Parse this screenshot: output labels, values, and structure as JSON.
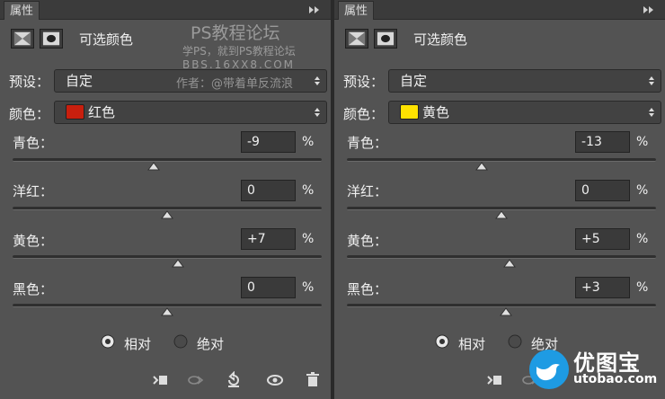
{
  "colors": {
    "panel_bg": "#535353",
    "red_swatch": "#c81f0e",
    "yellow_swatch": "#ffe200",
    "logo_blue": "#1e9be3"
  },
  "watermark": {
    "title": "PS教程论坛",
    "subtitle": "学PS，就到PS教程论坛",
    "url": "BBS.16XX8.COM",
    "author": "作者：@带着单反流浪"
  },
  "logo": {
    "name": "优图宝",
    "url": "utobao.com"
  },
  "panels": [
    {
      "tab": "属性",
      "heading": "可选颜色",
      "preset_label": "预设：",
      "preset_value": "自定",
      "color_label": "颜色：",
      "color_value": "红色",
      "sliders": [
        {
          "label": "青色：",
          "value": "-9",
          "unit": "%",
          "level": -9
        },
        {
          "label": "洋红：",
          "value": "0",
          "unit": "%",
          "level": 0
        },
        {
          "label": "黄色：",
          "value": "+7",
          "unit": "%",
          "level": 7
        },
        {
          "label": "黑色：",
          "value": "0",
          "unit": "%",
          "level": 0
        }
      ],
      "mode_relative": "相对",
      "mode_absolute": "绝对",
      "selected_mode": "relative"
    },
    {
      "tab": "属性",
      "heading": "可选颜色",
      "preset_label": "预设：",
      "preset_value": "自定",
      "color_label": "颜色：",
      "color_value": "黄色",
      "sliders": [
        {
          "label": "青色：",
          "value": "-13",
          "unit": "%",
          "level": -13
        },
        {
          "label": "洋红：",
          "value": "0",
          "unit": "%",
          "level": 0
        },
        {
          "label": "黄色：",
          "value": "+5",
          "unit": "%",
          "level": 5
        },
        {
          "label": "黑色：",
          "value": "+3",
          "unit": "%",
          "level": 3
        }
      ],
      "mode_relative": "相对",
      "mode_absolute": "绝对",
      "selected_mode": "relative"
    }
  ]
}
